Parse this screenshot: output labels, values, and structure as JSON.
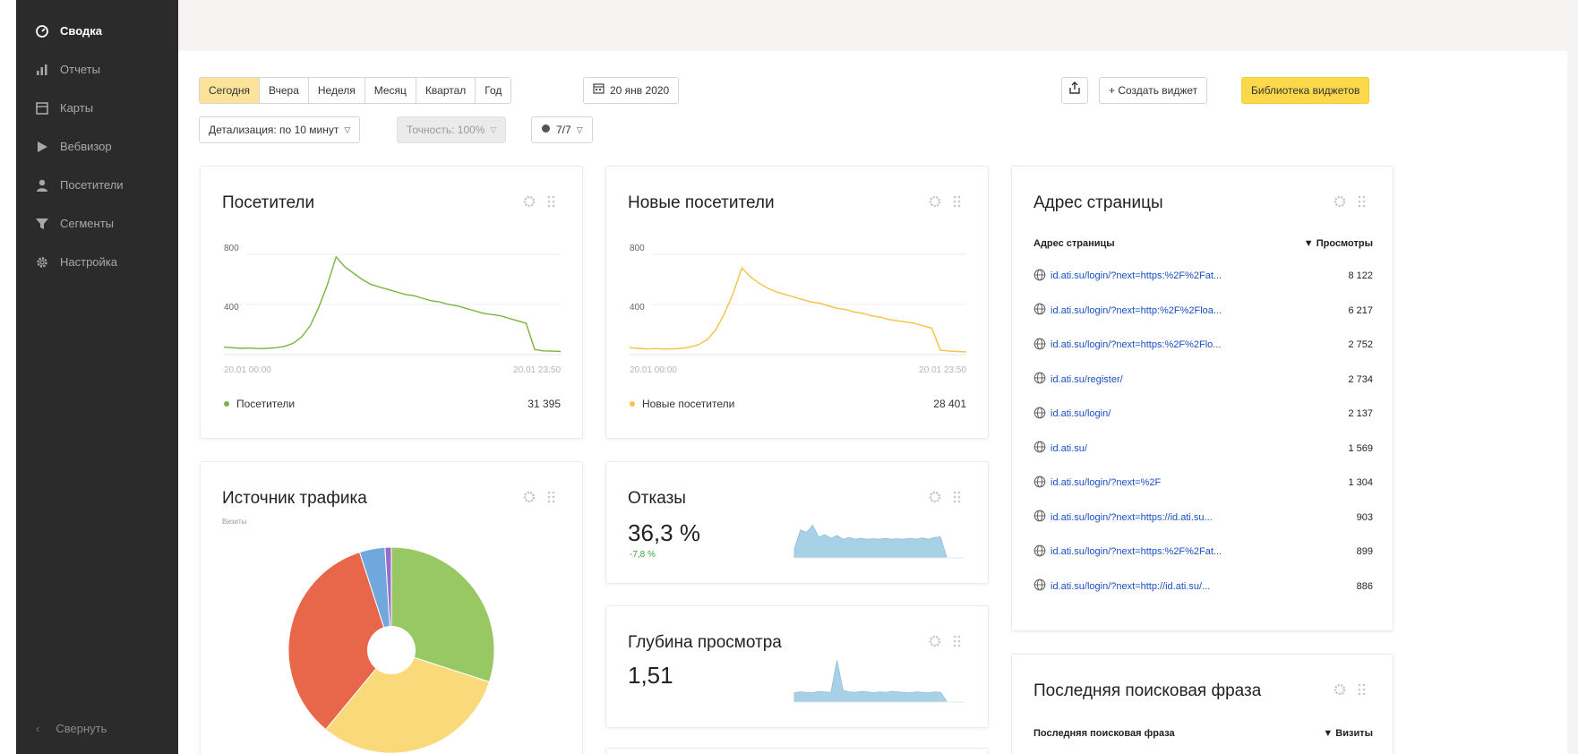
{
  "sidebar": {
    "items": [
      {
        "label": "Сводка",
        "icon": "dashboard-icon",
        "active": true
      },
      {
        "label": "Отчеты",
        "icon": "bar-chart-icon",
        "active": false
      },
      {
        "label": "Карты",
        "icon": "map-icon",
        "active": false
      },
      {
        "label": "Вебвизор",
        "icon": "play-icon",
        "active": false
      },
      {
        "label": "Посетители",
        "icon": "user-icon",
        "active": false
      },
      {
        "label": "Сегменты",
        "icon": "filter-icon",
        "active": false
      },
      {
        "label": "Настройка",
        "icon": "gear-icon",
        "active": false
      }
    ],
    "collapse_label": "Свернуть"
  },
  "toolbar": {
    "periods": [
      "Сегодня",
      "Вчера",
      "Неделя",
      "Месяц",
      "Квартал",
      "Год"
    ],
    "selected_period": "Сегодня",
    "date_label": "20 янв 2020",
    "detail_label": "Детализация: по 10 минут",
    "accuracy_label": "Точность: 100%",
    "segments_label": "7/7",
    "create_widget_label": "+ Создать виджет",
    "library_label": "Библиотека виджетов"
  },
  "colors": {
    "accent_yellow": "#fcd94b",
    "selected_period": "#fbe49a",
    "visitors_line": "#7cb342",
    "new_visitors_line": "#f5c242",
    "spark_fill": "#a8d0e6",
    "link": "#1a4fc2",
    "positive_delta": "#3aa33a"
  },
  "widgets": {
    "visitors": {
      "title": "Посетители",
      "y_ticks": [
        "800",
        "400"
      ],
      "x_start": "20.01 00:00",
      "x_end": "20.01 23:50",
      "legend": "Посетители",
      "total": "31 395"
    },
    "new_visitors": {
      "title": "Новые посетители",
      "y_ticks": [
        "800",
        "400"
      ],
      "x_start": "20.01 00:00",
      "x_end": "20.01 23:50",
      "legend": "Новые посетители",
      "total": "28 401"
    },
    "traffic": {
      "title": "Источник трафика",
      "subtitle": "Визиты"
    },
    "bounces": {
      "title": "Отказы",
      "value": "36,3 %",
      "delta": "-7,8 %"
    },
    "depth": {
      "title": "Глубина просмотра",
      "value": "1,51"
    },
    "pages": {
      "title": "Адрес страницы",
      "col_address": "Адрес страницы",
      "col_views": "▼ Просмотры",
      "rows": [
        {
          "url": "id.ati.su/login/?next=https:%2F%2Fat...",
          "views": "8 122"
        },
        {
          "url": "id.ati.su/login/?next=http:%2F%2Floa...",
          "views": "6 217"
        },
        {
          "url": "id.ati.su/login/?next=https:%2F%2Flo...",
          "views": "2 752"
        },
        {
          "url": "id.ati.su/register/",
          "views": "2 734"
        },
        {
          "url": "id.ati.su/login/",
          "views": "2 137"
        },
        {
          "url": "id.ati.su/",
          "views": "1 569"
        },
        {
          "url": "id.ati.su/login/?next=%2F",
          "views": "1 304"
        },
        {
          "url": "id.ati.su/login/?next=https://id.ati.su...",
          "views": "903"
        },
        {
          "url": "id.ati.su/login/?next=https:%2F%2Fat...",
          "views": "899"
        },
        {
          "url": "id.ati.su/login/?next=http://id.ati.su/...",
          "views": "886"
        }
      ]
    },
    "search_phrase": {
      "title": "Последняя поисковая фраза",
      "col_phrase": "Последняя поисковая фраза",
      "col_visits": "▼ Визиты"
    }
  },
  "chart_data": [
    {
      "type": "line",
      "series": [
        {
          "name": "Посетители",
          "values": [
            60,
            55,
            50,
            52,
            48,
            50,
            55,
            65,
            90,
            140,
            230,
            380,
            560,
            780,
            700,
            650,
            600,
            560,
            540,
            520,
            500,
            480,
            470,
            450,
            430,
            420,
            400,
            390,
            370,
            350,
            330,
            320,
            310,
            290,
            270,
            250,
            40,
            30,
            28,
            25
          ]
        }
      ],
      "ylim": [
        0,
        1000
      ]
    },
    {
      "type": "line",
      "series": [
        {
          "name": "Новые посетители",
          "values": [
            55,
            50,
            45,
            48,
            44,
            46,
            50,
            60,
            80,
            120,
            200,
            330,
            490,
            690,
            620,
            570,
            530,
            500,
            480,
            460,
            440,
            420,
            410,
            390,
            370,
            360,
            340,
            330,
            310,
            300,
            280,
            270,
            260,
            250,
            230,
            210,
            35,
            28,
            25,
            22
          ]
        }
      ],
      "ylim": [
        0,
        1000
      ]
    },
    {
      "type": "pie",
      "values": [
        30,
        31,
        34,
        4,
        1
      ],
      "colors": [
        "#97c864",
        "#fad97a",
        "#e8674a",
        "#6fa8dc",
        "#9b6bcb"
      ]
    },
    {
      "type": "area",
      "series": [
        {
          "name": "",
          "values": [
            0.2,
            0.6,
            0.55,
            0.7,
            0.45,
            0.5,
            0.42,
            0.48,
            0.4,
            0.44,
            0.4,
            0.42,
            0.4,
            0.41,
            0.4,
            0.42,
            0.4,
            0.41,
            0.4,
            0.42,
            0.4,
            0.43,
            0.4,
            0.44,
            0.45,
            0.02
          ]
        }
      ]
    },
    {
      "type": "area",
      "series": [
        {
          "name": "",
          "values": [
            0.2,
            0.22,
            0.21,
            0.2,
            0.23,
            0.22,
            0.21,
            0.9,
            0.25,
            0.22,
            0.21,
            0.23,
            0.22,
            0.2,
            0.22,
            0.21,
            0.23,
            0.22,
            0.21,
            0.2,
            0.22,
            0.21,
            0.2,
            0.22,
            0.21,
            0.02
          ]
        }
      ]
    }
  ]
}
